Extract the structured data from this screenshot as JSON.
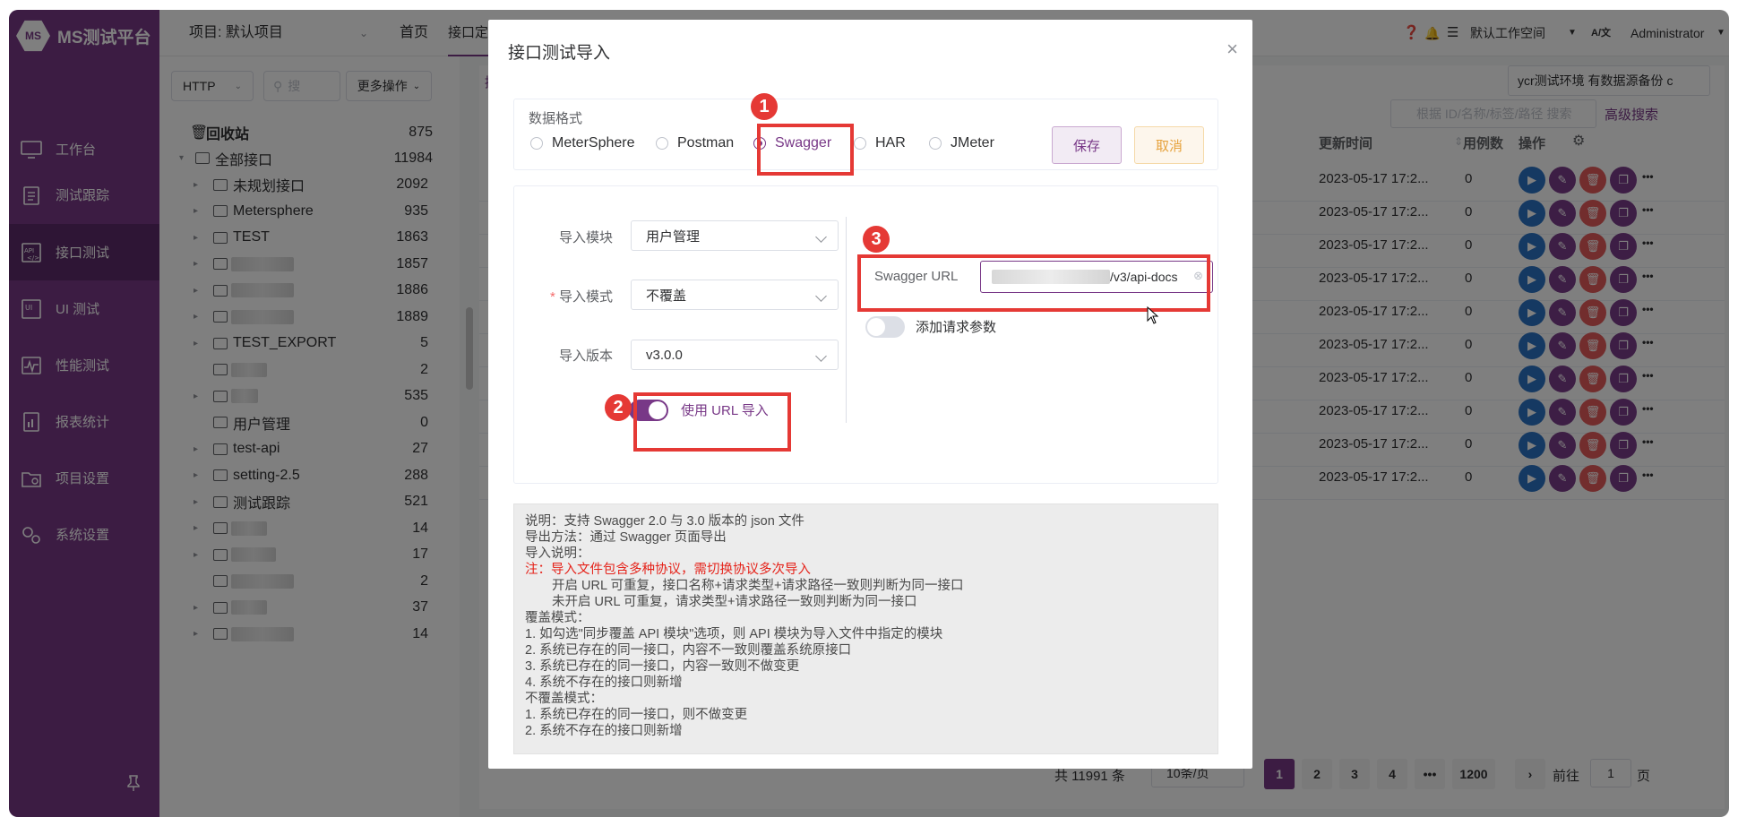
{
  "app": {
    "logo_text": "MS测试平台",
    "logo_badge": "MS"
  },
  "sidebar": {
    "items": [
      {
        "label": "工作台",
        "icon": "monitor-icon"
      },
      {
        "label": "测试跟踪",
        "icon": "clipboard-icon"
      },
      {
        "label": "接口测试",
        "icon": "api-icon"
      },
      {
        "label": "UI 测试",
        "icon": "ui-icon"
      },
      {
        "label": "性能测试",
        "icon": "performance-icon"
      },
      {
        "label": "报表统计",
        "icon": "report-icon"
      },
      {
        "label": "项目设置",
        "icon": "folder-settings-icon"
      },
      {
        "label": "系统设置",
        "icon": "gears-icon"
      }
    ],
    "active_index": 2
  },
  "topbar": {
    "project": "项目: 默认项目",
    "home": "首页",
    "api_def": "接口定义",
    "workspace": "默认工作空间",
    "lang": "A/文",
    "user": "Administrator"
  },
  "tree": {
    "protocol": "HTTP",
    "search_placeholder": "搜",
    "more_ops": "更多操作",
    "recycle": "回收站",
    "recycle_count": "875",
    "nodes": [
      {
        "label": "全部接口",
        "count": "11984"
      },
      {
        "label": "未规划接口",
        "count": "2092"
      },
      {
        "label": "Metersphere",
        "count": "935"
      },
      {
        "label": "TEST",
        "count": "1863"
      },
      {
        "label": "",
        "count": "1857"
      },
      {
        "label": "",
        "count": "1886"
      },
      {
        "label": "",
        "count": "1889"
      },
      {
        "label": "TEST_EXPORT",
        "count": "5"
      },
      {
        "label": "",
        "count": "2"
      },
      {
        "label": "",
        "count": "535"
      },
      {
        "label": "用户管理",
        "count": "0"
      },
      {
        "label": "test-api",
        "count": "27"
      },
      {
        "label": "setting-2.5",
        "count": "288"
      },
      {
        "label": "测试跟踪",
        "count": "521"
      },
      {
        "label": "",
        "count": "14"
      },
      {
        "label": "",
        "count": "17"
      },
      {
        "label": "",
        "count": "2"
      },
      {
        "label": "",
        "count": "37"
      },
      {
        "label": "",
        "count": "14"
      }
    ]
  },
  "content": {
    "tab_label": "接",
    "env": "ycr测试环境 有数据源备份 c",
    "search_placeholder": "根据 ID/名称/标签/路径 搜索",
    "adv_search": "高级搜索",
    "col_update": "更新时间",
    "col_cases": "用例数",
    "col_ops": "操作",
    "rows": [
      {
        "time": "2023-05-17 17:2...",
        "cases": "0"
      },
      {
        "time": "2023-05-17 17:2...",
        "cases": "0"
      },
      {
        "time": "2023-05-17 17:2...",
        "cases": "0"
      },
      {
        "time": "2023-05-17 17:2...",
        "cases": "0"
      },
      {
        "time": "2023-05-17 17:2...",
        "cases": "0"
      },
      {
        "time": "2023-05-17 17:2...",
        "cases": "0"
      },
      {
        "time": "2023-05-17 17:2...",
        "cases": "0"
      },
      {
        "time": "2023-05-17 17:2...",
        "cases": "0"
      },
      {
        "time": "2023-05-17 17:2...",
        "cases": "0"
      },
      {
        "time": "2023-05-17 17:2...",
        "cases": "0"
      }
    ],
    "more": "•••",
    "pager": {
      "total": "共 11991 条",
      "page_size": "10条/页",
      "pages": [
        "1",
        "2",
        "3",
        "4",
        "•••",
        "1200"
      ],
      "goto": "前往",
      "goto_value": "1",
      "page_unit": "页"
    }
  },
  "dialog": {
    "title": "接口测试导入",
    "format_label": "数据格式",
    "formats": [
      "MeterSphere",
      "Postman",
      "Swagger",
      "HAR",
      "JMeter"
    ],
    "selected_format": "Swagger",
    "save": "保存",
    "cancel": "取消",
    "module_label": "导入模块",
    "module_value": "用户管理",
    "mode_label": "导入模式",
    "mode_required": "*",
    "mode_value": "不覆盖",
    "version_label": "导入版本",
    "version_value": "v3.0.0",
    "use_url_label": "使用 URL 导入",
    "swagger_url_label": "Swagger URL",
    "swagger_url_suffix": "/v3/api-docs",
    "add_params_label": "添加请求参数",
    "badges": [
      "1",
      "2",
      "3"
    ],
    "note": {
      "l1": "说明：支持 Swagger 2.0 与 3.0 版本的 json 文件",
      "l2": "导出方法：通过 Swagger 页面导出",
      "l3": "导入说明：",
      "l4": "注：导入文件包含多种协议，需切换协议多次导入",
      "l5": "开启 URL 可重复，接口名称+请求类型+请求路径一致则判断为同一接口",
      "l6": "未开启 URL 可重复，请求类型+请求路径一致则判断为同一接口",
      "l7": "覆盖模式：",
      "l8": "1. 如勾选\"同步覆盖 API 模块\"选项，则 API 模块为导入文件中指定的模块",
      "l9": "2. 系统已存在的同一接口，内容不一致则覆盖系统原接口",
      "l10": "3. 系统已存在的同一接口，内容一致则不做变更",
      "l11": "4. 系统不存在的接口则新增",
      "l12": "不覆盖模式：",
      "l13": "1. 系统已存在的同一接口，则不做变更",
      "l14": "2. 系统不存在的接口则新增"
    }
  }
}
